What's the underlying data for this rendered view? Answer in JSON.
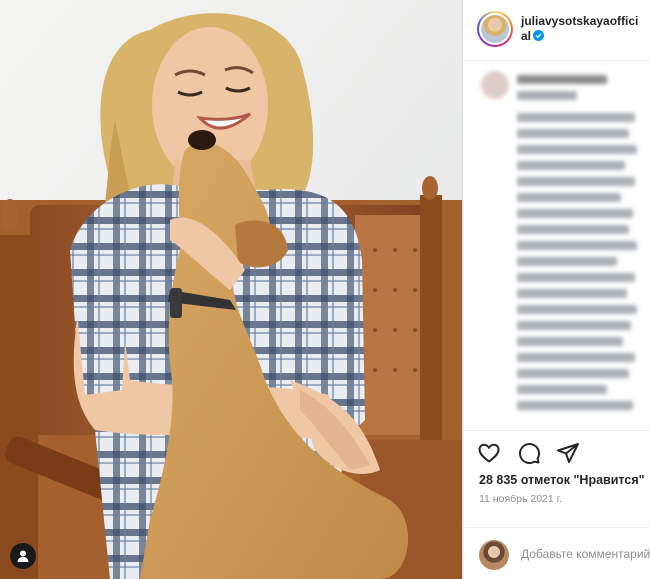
{
  "post": {
    "username": "juliavysotskayaofficial",
    "verified": true,
    "likes_text": "28 835 отметок \"Нравится\"",
    "date_text": "11 ноябрь 2021 г.",
    "comment_placeholder": "Добавьте комментарий..."
  },
  "icons": {
    "like": "heart-icon",
    "comment": "speech-bubble-icon",
    "share": "paper-plane-icon",
    "tagged": "user-icon",
    "verified": "verified-badge-icon"
  },
  "colors": {
    "verified_blue": "#0095f6",
    "border": "#dbdbdb",
    "secondary_text": "#8e8e8e",
    "primary_text": "#262626"
  }
}
